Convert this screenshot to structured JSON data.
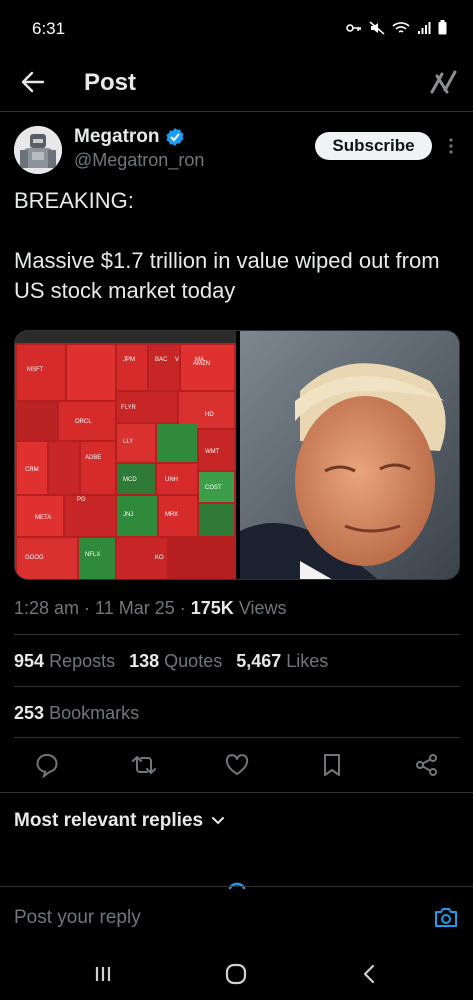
{
  "status_bar": {
    "time": "6:31",
    "icons": [
      "key-icon",
      "mute-icon",
      "wifi-icon",
      "signal-icon",
      "battery-icon"
    ]
  },
  "header": {
    "title": "Post",
    "back_icon": "back-arrow-icon",
    "grok_icon": "grok-icon"
  },
  "author": {
    "name": "Megatron",
    "handle": "@Megatron_ron",
    "verified": true,
    "subscribe_label": "Subscribe"
  },
  "tweet": {
    "text": "BREAKING:\n\nMassive $1.7 trillion in value wiped out from US stock market today"
  },
  "media": {
    "image1_labels": [
      "MSFT",
      "ORCL",
      "FLYR",
      "ADBE",
      "CRM",
      "LLY",
      "UNH",
      "JNJ",
      "MRK",
      "AMZN",
      "WMT",
      "COST",
      "GOOG",
      "META",
      "NFLX",
      "HD",
      "MCD",
      "JPM",
      "BAC",
      "V",
      "MA",
      "PG",
      "KO"
    ]
  },
  "meta": {
    "time": "1:28 am",
    "date": "11 Mar 25",
    "views_count": "175K",
    "views_label": "Views"
  },
  "stats": {
    "reposts_count": "954",
    "reposts_label": "Reposts",
    "quotes_count": "138",
    "quotes_label": "Quotes",
    "likes_count": "5,467",
    "likes_label": "Likes",
    "bookmarks_count": "253",
    "bookmarks_label": "Bookmarks"
  },
  "replies": {
    "heading": "Most relevant replies",
    "placeholder": "Post your reply"
  },
  "colors": {
    "background": "#000000",
    "text": "#e7e9ea",
    "muted": "#71767b",
    "accent": "#1d9bf0",
    "divider": "#2f3336"
  }
}
